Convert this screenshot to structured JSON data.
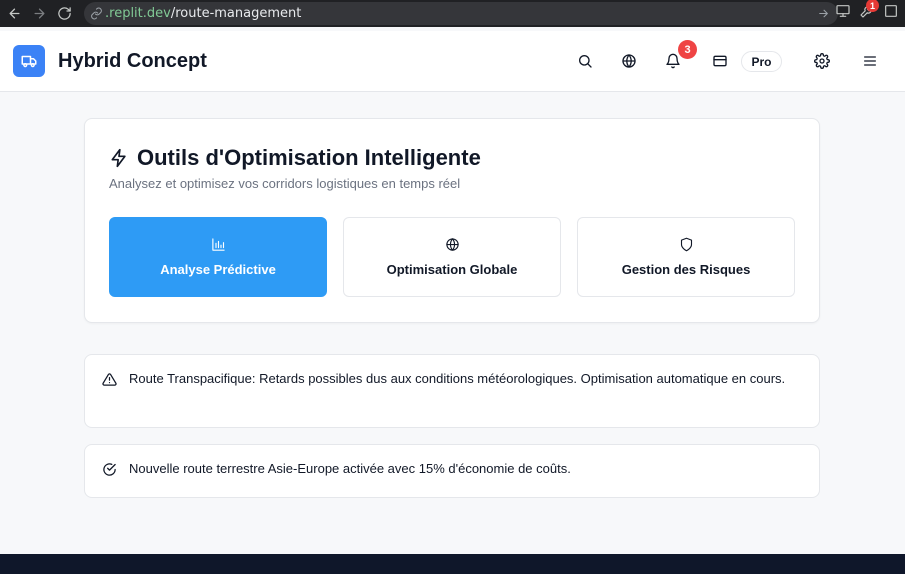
{
  "browser": {
    "url_domain": ".replit.dev",
    "url_path": "/route-management",
    "extension_badge": "1"
  },
  "header": {
    "brand": "Hybrid Concept",
    "notification_count": "3",
    "plan_badge": "Pro"
  },
  "tools_card": {
    "title": "Outils d'Optimisation Intelligente",
    "subtitle": "Analysez et optimisez vos corridors logistiques en temps réel",
    "tools": [
      {
        "label": "Analyse Prédictive",
        "icon": "bar-chart-icon",
        "active": true
      },
      {
        "label": "Optimisation Globale",
        "icon": "globe-icon",
        "active": false
      },
      {
        "label": "Gestion des Risques",
        "icon": "shield-icon",
        "active": false
      }
    ]
  },
  "alerts": [
    {
      "icon": "warning-triangle-icon",
      "text": "Route Transpacifique: Retards possibles dus aux conditions météorologiques. Optimisation automatique en cours."
    },
    {
      "icon": "check-circle-icon",
      "text": "Nouvelle route terrestre Asie-Europe activée avec 15% d'économie de coûts."
    }
  ],
  "colors": {
    "accent": "#2e9bf5",
    "logo": "#3b82f6",
    "badge": "#ef4444",
    "footer": "#0f172a"
  }
}
